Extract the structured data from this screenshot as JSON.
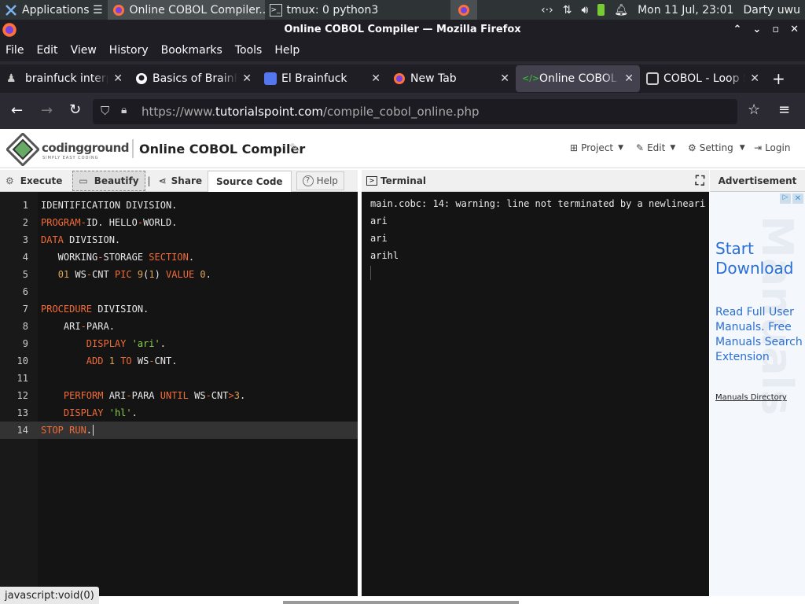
{
  "taskbar": {
    "items": [
      {
        "label": "Applications ☰"
      },
      {
        "label": "Online COBOL Compiler..."
      },
      {
        "label": "tmux: 0 python3"
      }
    ],
    "clock": "Mon 11 Jul, 23:01",
    "user": "Darty uwu"
  },
  "window": {
    "title": "Online COBOL Compiler — Mozilla Firefox"
  },
  "menu": [
    "File",
    "Edit",
    "View",
    "History",
    "Bookmarks",
    "Tools",
    "Help"
  ],
  "tabs": [
    {
      "label": "brainfuck interpreter"
    },
    {
      "label": "Basics of BrainFuck"
    },
    {
      "label": "El Brainfuck"
    },
    {
      "label": "New Tab"
    },
    {
      "label": "Online COBOL Compiler"
    },
    {
      "label": "COBOL - Loop Statements"
    }
  ],
  "url": {
    "prefix": "https://www.",
    "domain": "tutorialspoint.com",
    "path": "/compile_cobol_online.php"
  },
  "site": {
    "logo": "codingground",
    "logo_sub": "SIMPLY EASY CODING",
    "title": "Online COBOL Compiler",
    "nav": {
      "project": "Project",
      "edit": "Edit",
      "setting": "Setting",
      "login": "Login"
    }
  },
  "editor_toolbar": {
    "execute": "Execute",
    "beautify": "Beautify",
    "share": "Share",
    "source": "Source Code",
    "help": "Help"
  },
  "terminal_toolbar": {
    "title": "Terminal",
    "ad_label": "Advertisement"
  },
  "code_lines": [
    "IDENTIFICATION DIVISION.",
    "PROGRAM-ID. HELLO-WORLD.",
    "DATA DIVISION.",
    "   WORKING-STORAGE SECTION.",
    "   01 WS-CNT PIC 9(1) VALUE 0.",
    "",
    "PROCEDURE DIVISION.",
    "    ARI-PARA.",
    "        DISPLAY 'ari'.",
    "        ADD 1 TO WS-CNT.",
    "",
    "    PERFORM ARI-PARA UNTIL WS-CNT>3.",
    "    DISPLAY 'hl'.",
    "STOP RUN."
  ],
  "line_numbers": [
    "1",
    "2",
    "3",
    "4",
    "5",
    "6",
    "7",
    "8",
    "9",
    "10",
    "11",
    "12",
    "13",
    "14"
  ],
  "terminal_output": [
    "main.cobc: 14: warning: line not terminated by a newlineari",
    "ari",
    "ari",
    "arihl"
  ],
  "ad": {
    "headline1": "Start",
    "headline2": "Download",
    "body": "Read Full User Manuals. Free Manuals Search Extension",
    "link": "Manuals Directory"
  },
  "status": "javascript:void(0)",
  "colors": {
    "keyword": "#f26b38",
    "string": "#8bd14b",
    "number": "#d8a356",
    "ad_blue": "#2a6fd6"
  }
}
